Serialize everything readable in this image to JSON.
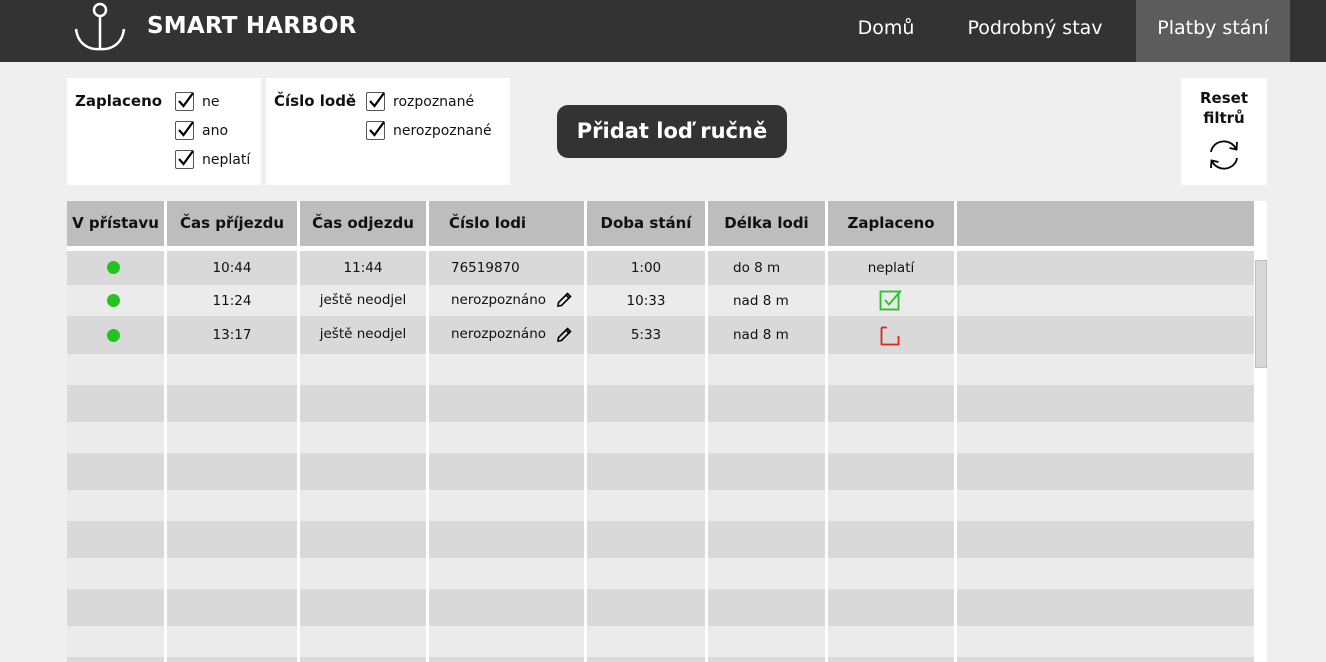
{
  "header": {
    "brand": "SMART HARBOR",
    "logo_icon": "anchor-icon",
    "nav": [
      "Domů",
      "Podrobný stav",
      "Platby stání"
    ],
    "active_nav": "Platby stání"
  },
  "filters": {
    "paid": {
      "title": "Zaplaceno",
      "options": [
        {
          "label": "ne",
          "checked": true
        },
        {
          "label": "ano",
          "checked": true
        },
        {
          "label": "neplatí",
          "checked": true
        }
      ]
    },
    "ship_number": {
      "title": "Číslo lodě",
      "options": [
        {
          "label": "rozpoznané",
          "checked": true
        },
        {
          "label": "nerozpoznané",
          "checked": true
        }
      ]
    },
    "reset": {
      "label_line1": "Reset",
      "label_line2": "filtrů",
      "icon": "refresh-icon"
    }
  },
  "add_button": "Přidat loď ručně",
  "table": {
    "columns": [
      "V přístavu",
      "Čas příjezdu",
      "Čas odjezdu",
      "Číslo lodi",
      "Doba stání",
      "Délka lodi",
      "Zaplaceno"
    ],
    "rows": [
      {
        "in_harbor": true,
        "arrival": "10:44",
        "departure": "11:44",
        "ship_number": "76519870",
        "editable": false,
        "duration": "1:00",
        "length": "do 8 m",
        "paid": "neplatí",
        "paid_state": "text"
      },
      {
        "in_harbor": true,
        "arrival": "11:24",
        "departure": "ještě neodjel",
        "ship_number": "nerozpoznáno",
        "editable": true,
        "duration": "10:33",
        "length": "nad 8 m",
        "paid": "",
        "paid_state": "checked"
      },
      {
        "in_harbor": true,
        "arrival": "13:17",
        "departure": "ještě neodjel",
        "ship_number": "nerozpoznáno",
        "editable": true,
        "duration": "5:33",
        "length": "nad 8 m",
        "paid": "",
        "paid_state": "unchecked"
      }
    ]
  },
  "colors": {
    "header_bg": "#333333",
    "active_nav_bg": "#5c5c5c",
    "in_harbor_dot": "#22c41f",
    "paid_ok": "#22c41f",
    "paid_missing": "#e0231b"
  }
}
